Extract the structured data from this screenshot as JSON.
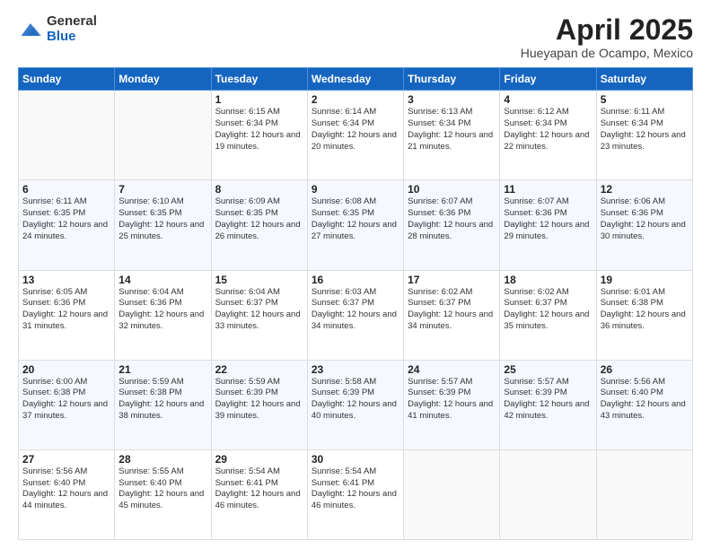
{
  "logo": {
    "general": "General",
    "blue": "Blue"
  },
  "header": {
    "month_title": "April 2025",
    "subtitle": "Hueyapan de Ocampo, Mexico"
  },
  "weekdays": [
    "Sunday",
    "Monday",
    "Tuesday",
    "Wednesday",
    "Thursday",
    "Friday",
    "Saturday"
  ],
  "weeks": [
    [
      {
        "day": "",
        "sunrise": "",
        "sunset": "",
        "daylight": "",
        "empty": true
      },
      {
        "day": "",
        "sunrise": "",
        "sunset": "",
        "daylight": "",
        "empty": true
      },
      {
        "day": "1",
        "sunrise": "Sunrise: 6:15 AM",
        "sunset": "Sunset: 6:34 PM",
        "daylight": "Daylight: 12 hours and 19 minutes."
      },
      {
        "day": "2",
        "sunrise": "Sunrise: 6:14 AM",
        "sunset": "Sunset: 6:34 PM",
        "daylight": "Daylight: 12 hours and 20 minutes."
      },
      {
        "day": "3",
        "sunrise": "Sunrise: 6:13 AM",
        "sunset": "Sunset: 6:34 PM",
        "daylight": "Daylight: 12 hours and 21 minutes."
      },
      {
        "day": "4",
        "sunrise": "Sunrise: 6:12 AM",
        "sunset": "Sunset: 6:34 PM",
        "daylight": "Daylight: 12 hours and 22 minutes."
      },
      {
        "day": "5",
        "sunrise": "Sunrise: 6:11 AM",
        "sunset": "Sunset: 6:34 PM",
        "daylight": "Daylight: 12 hours and 23 minutes."
      }
    ],
    [
      {
        "day": "6",
        "sunrise": "Sunrise: 6:11 AM",
        "sunset": "Sunset: 6:35 PM",
        "daylight": "Daylight: 12 hours and 24 minutes."
      },
      {
        "day": "7",
        "sunrise": "Sunrise: 6:10 AM",
        "sunset": "Sunset: 6:35 PM",
        "daylight": "Daylight: 12 hours and 25 minutes."
      },
      {
        "day": "8",
        "sunrise": "Sunrise: 6:09 AM",
        "sunset": "Sunset: 6:35 PM",
        "daylight": "Daylight: 12 hours and 26 minutes."
      },
      {
        "day": "9",
        "sunrise": "Sunrise: 6:08 AM",
        "sunset": "Sunset: 6:35 PM",
        "daylight": "Daylight: 12 hours and 27 minutes."
      },
      {
        "day": "10",
        "sunrise": "Sunrise: 6:07 AM",
        "sunset": "Sunset: 6:36 PM",
        "daylight": "Daylight: 12 hours and 28 minutes."
      },
      {
        "day": "11",
        "sunrise": "Sunrise: 6:07 AM",
        "sunset": "Sunset: 6:36 PM",
        "daylight": "Daylight: 12 hours and 29 minutes."
      },
      {
        "day": "12",
        "sunrise": "Sunrise: 6:06 AM",
        "sunset": "Sunset: 6:36 PM",
        "daylight": "Daylight: 12 hours and 30 minutes."
      }
    ],
    [
      {
        "day": "13",
        "sunrise": "Sunrise: 6:05 AM",
        "sunset": "Sunset: 6:36 PM",
        "daylight": "Daylight: 12 hours and 31 minutes."
      },
      {
        "day": "14",
        "sunrise": "Sunrise: 6:04 AM",
        "sunset": "Sunset: 6:36 PM",
        "daylight": "Daylight: 12 hours and 32 minutes."
      },
      {
        "day": "15",
        "sunrise": "Sunrise: 6:04 AM",
        "sunset": "Sunset: 6:37 PM",
        "daylight": "Daylight: 12 hours and 33 minutes."
      },
      {
        "day": "16",
        "sunrise": "Sunrise: 6:03 AM",
        "sunset": "Sunset: 6:37 PM",
        "daylight": "Daylight: 12 hours and 34 minutes."
      },
      {
        "day": "17",
        "sunrise": "Sunrise: 6:02 AM",
        "sunset": "Sunset: 6:37 PM",
        "daylight": "Daylight: 12 hours and 34 minutes."
      },
      {
        "day": "18",
        "sunrise": "Sunrise: 6:02 AM",
        "sunset": "Sunset: 6:37 PM",
        "daylight": "Daylight: 12 hours and 35 minutes."
      },
      {
        "day": "19",
        "sunrise": "Sunrise: 6:01 AM",
        "sunset": "Sunset: 6:38 PM",
        "daylight": "Daylight: 12 hours and 36 minutes."
      }
    ],
    [
      {
        "day": "20",
        "sunrise": "Sunrise: 6:00 AM",
        "sunset": "Sunset: 6:38 PM",
        "daylight": "Daylight: 12 hours and 37 minutes."
      },
      {
        "day": "21",
        "sunrise": "Sunrise: 5:59 AM",
        "sunset": "Sunset: 6:38 PM",
        "daylight": "Daylight: 12 hours and 38 minutes."
      },
      {
        "day": "22",
        "sunrise": "Sunrise: 5:59 AM",
        "sunset": "Sunset: 6:39 PM",
        "daylight": "Daylight: 12 hours and 39 minutes."
      },
      {
        "day": "23",
        "sunrise": "Sunrise: 5:58 AM",
        "sunset": "Sunset: 6:39 PM",
        "daylight": "Daylight: 12 hours and 40 minutes."
      },
      {
        "day": "24",
        "sunrise": "Sunrise: 5:57 AM",
        "sunset": "Sunset: 6:39 PM",
        "daylight": "Daylight: 12 hours and 41 minutes."
      },
      {
        "day": "25",
        "sunrise": "Sunrise: 5:57 AM",
        "sunset": "Sunset: 6:39 PM",
        "daylight": "Daylight: 12 hours and 42 minutes."
      },
      {
        "day": "26",
        "sunrise": "Sunrise: 5:56 AM",
        "sunset": "Sunset: 6:40 PM",
        "daylight": "Daylight: 12 hours and 43 minutes."
      }
    ],
    [
      {
        "day": "27",
        "sunrise": "Sunrise: 5:56 AM",
        "sunset": "Sunset: 6:40 PM",
        "daylight": "Daylight: 12 hours and 44 minutes."
      },
      {
        "day": "28",
        "sunrise": "Sunrise: 5:55 AM",
        "sunset": "Sunset: 6:40 PM",
        "daylight": "Daylight: 12 hours and 45 minutes."
      },
      {
        "day": "29",
        "sunrise": "Sunrise: 5:54 AM",
        "sunset": "Sunset: 6:41 PM",
        "daylight": "Daylight: 12 hours and 46 minutes."
      },
      {
        "day": "30",
        "sunrise": "Sunrise: 5:54 AM",
        "sunset": "Sunset: 6:41 PM",
        "daylight": "Daylight: 12 hours and 46 minutes."
      },
      {
        "day": "",
        "sunrise": "",
        "sunset": "",
        "daylight": "",
        "empty": true
      },
      {
        "day": "",
        "sunrise": "",
        "sunset": "",
        "daylight": "",
        "empty": true
      },
      {
        "day": "",
        "sunrise": "",
        "sunset": "",
        "daylight": "",
        "empty": true
      }
    ]
  ]
}
